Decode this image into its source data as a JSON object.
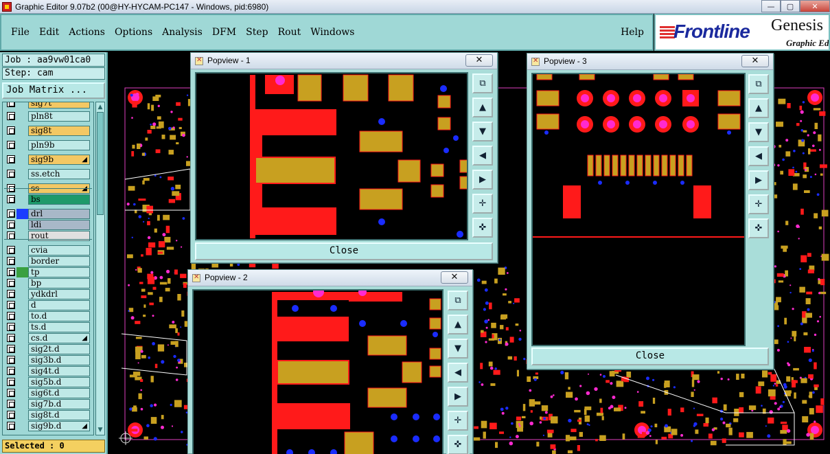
{
  "window": {
    "title": "Graphic Editor 9.07b2 (00@HY-HYCAM-PC147 - Windows, pid:6980)",
    "minimize_icon": "minimize-icon",
    "maximize_icon": "maximize-icon",
    "close_icon": "close-icon"
  },
  "menu": {
    "items": [
      "File",
      "Edit",
      "Actions",
      "Options",
      "Analysis",
      "DFM",
      "Step",
      "Rout",
      "Windows"
    ],
    "help": "Help"
  },
  "brand": {
    "logo_text": "Frontline",
    "product": "Genesis",
    "subtitle": "Graphic Ed"
  },
  "left_panel": {
    "job": "Job : aa9vw01ca0",
    "step": "Step: cam",
    "job_matrix": "Job Matrix ...",
    "selected": "Selected : 0"
  },
  "layers": [
    {
      "name": "sig7t",
      "bg": "#f3c864",
      "swatch": "",
      "mark": ""
    },
    {
      "name": "pln8t",
      "bg": "#bfe9e7",
      "swatch": "",
      "mark": ""
    },
    {
      "name": "sig8t",
      "bg": "#f3c864",
      "swatch": "",
      "mark": ""
    },
    {
      "name": "pln9b",
      "bg": "#bfe9e7",
      "swatch": "",
      "mark": ""
    },
    {
      "name": "sig9b",
      "bg": "#f3c864",
      "swatch": "",
      "mark": "◢"
    },
    {
      "name": "ss.etch",
      "bg": "#bfe9e7",
      "swatch": "",
      "mark": ""
    },
    {
      "name": "ss",
      "bg": "#f3c864",
      "swatch": "",
      "mark": "◢"
    },
    {
      "name": "bs",
      "bg": "#1e9a6a",
      "swatch": "",
      "mark": ""
    },
    {
      "name": "drl",
      "bg": "#a8b8c8",
      "swatch": "#1c3cff",
      "mark": ""
    },
    {
      "name": "ldi",
      "bg": "#a8b8c8",
      "swatch": "",
      "mark": ""
    },
    {
      "name": "rout",
      "bg": "#e0e0e0",
      "swatch": "",
      "mark": ""
    },
    {
      "name": "cvia",
      "bg": "#bfe9e7",
      "swatch": "",
      "mark": ""
    },
    {
      "name": "border",
      "bg": "#bfe9e7",
      "swatch": "",
      "mark": ""
    },
    {
      "name": "tp",
      "bg": "#bfe9e7",
      "swatch": "#3aa040",
      "mark": ""
    },
    {
      "name": "bp",
      "bg": "#bfe9e7",
      "swatch": "",
      "mark": ""
    },
    {
      "name": "ydkdrl",
      "bg": "#bfe9e7",
      "swatch": "",
      "mark": ""
    },
    {
      "name": "d",
      "bg": "#bfe9e7",
      "swatch": "",
      "mark": ""
    },
    {
      "name": "to.d",
      "bg": "#bfe9e7",
      "swatch": "",
      "mark": ""
    },
    {
      "name": "ts.d",
      "bg": "#bfe9e7",
      "swatch": "",
      "mark": ""
    },
    {
      "name": "cs.d",
      "bg": "#bfe9e7",
      "swatch": "",
      "mark": "◢"
    },
    {
      "name": "sig2t.d",
      "bg": "#bfe9e7",
      "swatch": "",
      "mark": ""
    },
    {
      "name": "sig3b.d",
      "bg": "#bfe9e7",
      "swatch": "",
      "mark": ""
    },
    {
      "name": "sig4t.d",
      "bg": "#bfe9e7",
      "swatch": "",
      "mark": ""
    },
    {
      "name": "sig5b.d",
      "bg": "#bfe9e7",
      "swatch": "",
      "mark": ""
    },
    {
      "name": "sig6t.d",
      "bg": "#bfe9e7",
      "swatch": "",
      "mark": ""
    },
    {
      "name": "sig7b.d",
      "bg": "#bfe9e7",
      "swatch": "",
      "mark": ""
    },
    {
      "name": "sig8t.d",
      "bg": "#bfe9e7",
      "swatch": "",
      "mark": ""
    },
    {
      "name": "sig9b.d",
      "bg": "#bfe9e7",
      "swatch": "",
      "mark": "◢"
    }
  ],
  "popviews": {
    "p1": {
      "title": "Popview - 1",
      "close": "Close",
      "x_label": "✕"
    },
    "p2": {
      "title": "Popview - 2",
      "x_label": "✕"
    },
    "p3": {
      "title": "Popview - 3",
      "close": "Close",
      "x_label": "✕"
    }
  },
  "tools": [
    {
      "name": "zoom-fit-icon",
      "glyph": "⧉"
    },
    {
      "name": "pan-up-icon",
      "glyph": "▲"
    },
    {
      "name": "pan-down-icon",
      "glyph": "▼"
    },
    {
      "name": "pan-left-icon",
      "glyph": "◀"
    },
    {
      "name": "pan-right-icon",
      "glyph": "▶"
    },
    {
      "name": "zoom-in-icon",
      "glyph": "✛"
    },
    {
      "name": "zoom-out-icon",
      "glyph": "✜"
    }
  ],
  "colors": {
    "panel": "#9fd8d6",
    "pad_red": "#ff1a1a",
    "pad_gold": "#c8a020",
    "via_blue": "#1a2cff",
    "pin_magenta": "#ff2ad0"
  }
}
